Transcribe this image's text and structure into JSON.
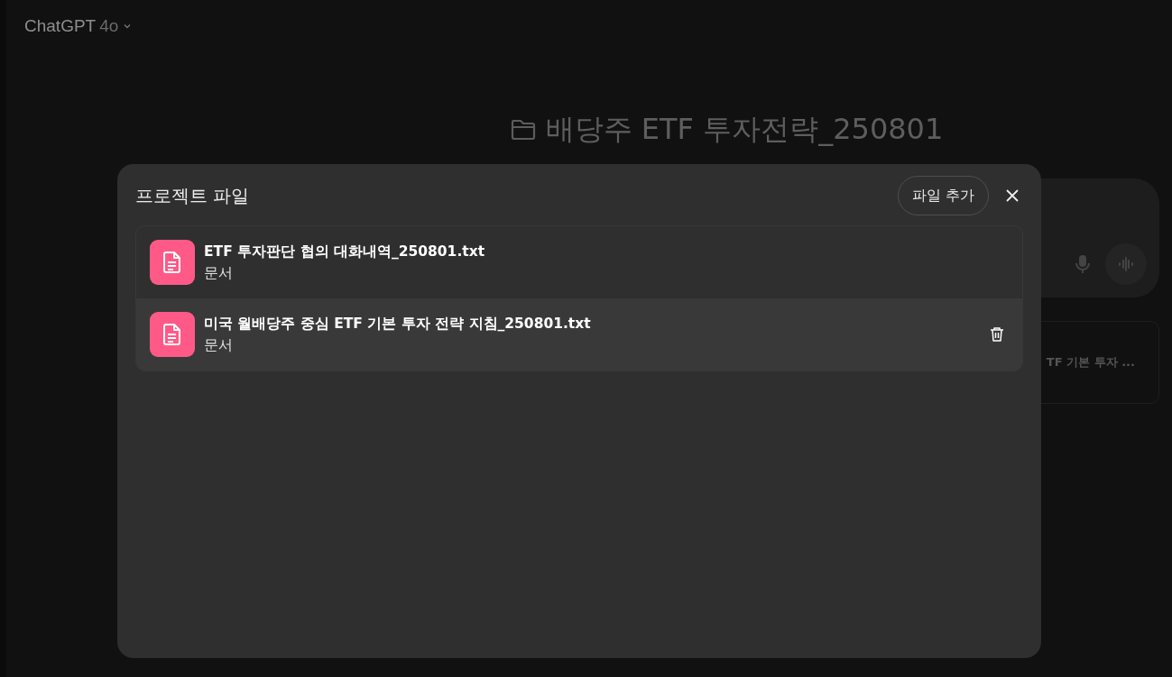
{
  "header": {
    "model_name": "ChatGPT",
    "model_version": "4o"
  },
  "project": {
    "title": "배당주 ETF 투자전략_250801"
  },
  "background_card": {
    "text": "TF 기본 투자 ..."
  },
  "dialog": {
    "title": "프로젝트 파일",
    "add_button": "파일 추가",
    "files": [
      {
        "name": "ETF 투자판단 협의 대화내역_250801.txt",
        "type": "문서",
        "highlighted": false
      },
      {
        "name": "미국 월배당주 중심 ETF 기본 투자 전략 지침_250801.txt",
        "type": "문서",
        "highlighted": true
      }
    ]
  }
}
